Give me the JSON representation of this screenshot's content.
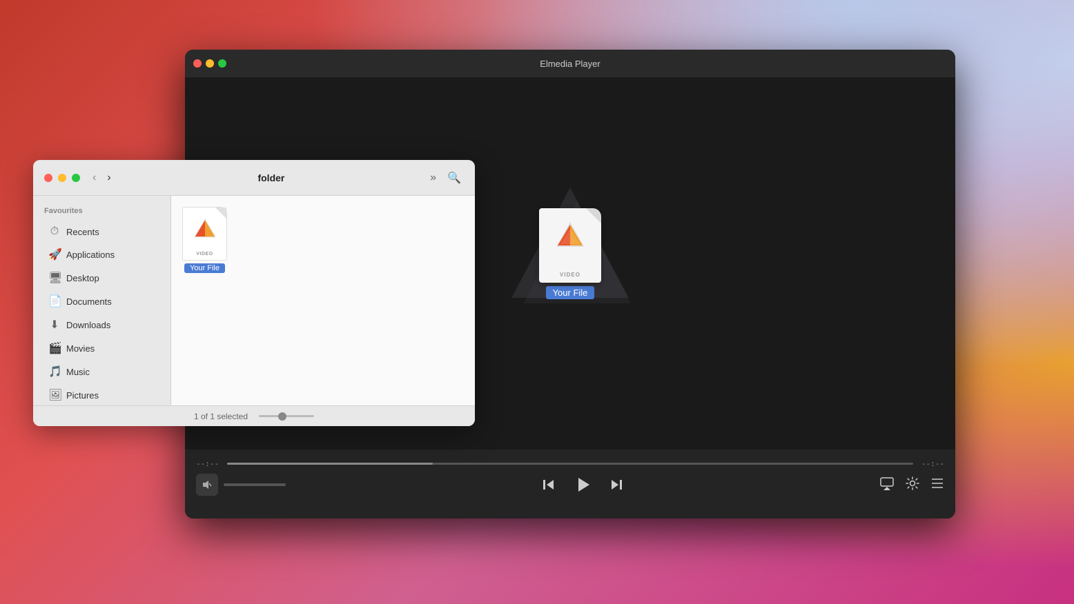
{
  "desktop": {
    "bg": "macOS Big Sur desktop"
  },
  "player": {
    "title": "Elmedia Player",
    "traffic_lights": [
      "#ff5f57",
      "#febc2e",
      "#28c840"
    ],
    "file_name": "Your File",
    "file_type": "VIDEO",
    "time_start": "--:--",
    "time_end": "--:--",
    "controls": {
      "prev_label": "⏮",
      "play_label": "▶",
      "next_label": "⏭",
      "airplay_label": "⊕",
      "settings_label": "⚙",
      "playlist_label": "☰"
    }
  },
  "finder": {
    "title": "folder",
    "traffic_lights": [
      "#ff5f57",
      "#febc2e",
      "#28c840"
    ],
    "sidebar": {
      "section_label": "Favourites",
      "items": [
        {
          "icon": "🕐",
          "label": "Recents"
        },
        {
          "icon": "🚀",
          "label": "Applications"
        },
        {
          "icon": "🖥",
          "label": "Desktop"
        },
        {
          "icon": "📄",
          "label": "Documents"
        },
        {
          "icon": "⬇",
          "label": "Downloads"
        },
        {
          "icon": "🎬",
          "label": "Movies"
        },
        {
          "icon": "🎵",
          "label": "Music"
        },
        {
          "icon": "🖼",
          "label": "Pictures"
        }
      ]
    },
    "file": {
      "name": "Your File",
      "type": "VIDEO"
    },
    "status": "1 of 1 selected"
  }
}
